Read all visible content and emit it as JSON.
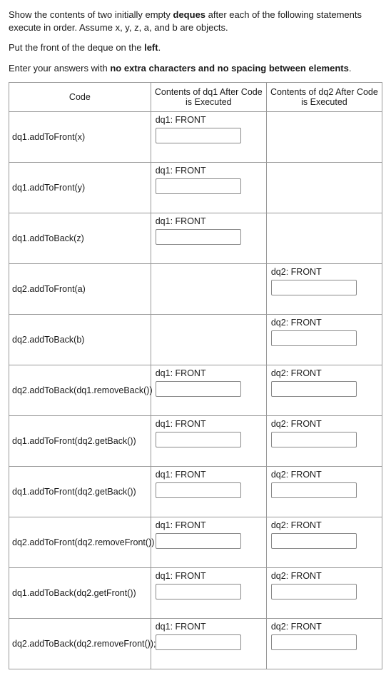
{
  "intro": {
    "p1a": "Show the contents of two initially empty ",
    "p1_bold": "deques",
    "p1b": " after each of the following statements execute in order. Assume x, y, z, a, and b are objects.",
    "p2a": "Put the front of the deque on the ",
    "p2_bold": "left",
    "p2b": ".",
    "p3a": "Enter your answers with ",
    "p3_bold": "no extra characters and no spacing between elements",
    "p3b": "."
  },
  "headers": {
    "code": "Code",
    "dq1": "Contents of dq1 After Code is Executed",
    "dq2": "Contents of dq2 After Code is Executed"
  },
  "labels": {
    "dq1": "dq1: FRONT",
    "dq2": "dq2: FRONT"
  },
  "rows": [
    {
      "code": "dq1.addToFront(x)",
      "dq1": true,
      "dq2": false
    },
    {
      "code": "dq1.addToFront(y)",
      "dq1": true,
      "dq2": false
    },
    {
      "code": "dq1.addToBack(z)",
      "dq1": true,
      "dq2": false
    },
    {
      "code": "dq2.addToFront(a)",
      "dq1": false,
      "dq2": true
    },
    {
      "code": "dq2.addToBack(b)",
      "dq1": false,
      "dq2": true
    },
    {
      "code": "dq2.addToBack(dq1.removeBack())",
      "dq1": true,
      "dq2": true
    },
    {
      "code": "dq1.addToFront(dq2.getBack())",
      "dq1": true,
      "dq2": true
    },
    {
      "code": "dq1.addToFront(dq2.getBack())",
      "dq1": true,
      "dq2": true
    },
    {
      "code": "dq2.addToFront(dq2.removeFront())",
      "dq1": true,
      "dq2": true
    },
    {
      "code": "dq1.addToBack(dq2.getFront())",
      "dq1": true,
      "dq2": true
    },
    {
      "code": "dq2.addToBack(dq2.removeFront());",
      "dq1": true,
      "dq2": true
    }
  ]
}
